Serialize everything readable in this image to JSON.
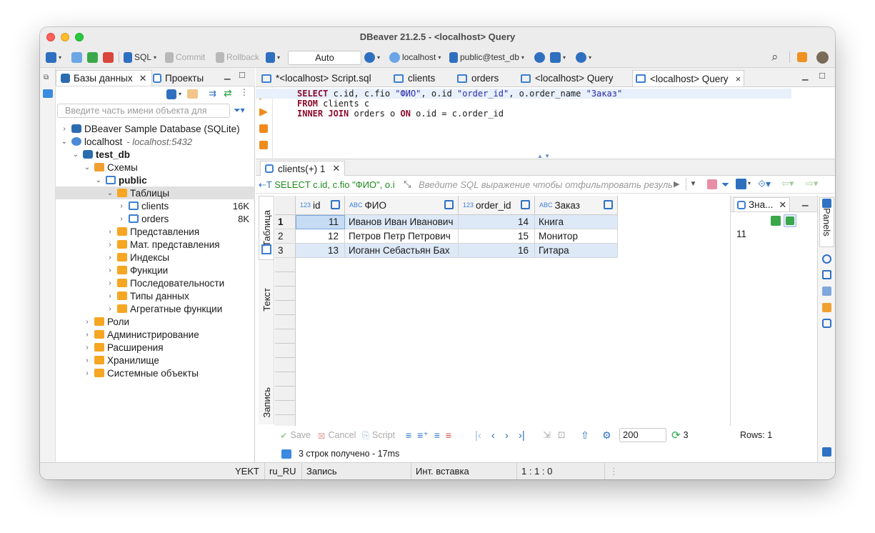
{
  "window": {
    "title": "DBeaver 21.2.5 - <localhost> Query"
  },
  "toolbar": {
    "sql_label": "SQL",
    "commit_label": "Commit",
    "rollback_label": "Rollback",
    "transaction_mode": "Auto",
    "connection_label": "localhost",
    "schema_label": "public@test_db"
  },
  "navigator": {
    "tab_databases": "Базы данных",
    "tab_projects": "Проекты",
    "filter_placeholder": "Введите часть имени объекта для"
  },
  "tree": [
    {
      "label": "DBeaver Sample Database (SQLite)",
      "arrow": "›",
      "icon": "sqlite-icon"
    },
    {
      "label": "localhost",
      "suffix": "- localhost:5432",
      "arrow": "⌄",
      "icon": "postgres-connection-icon"
    },
    {
      "label": "test_db",
      "arrow": "⌄",
      "icon": "database-icon"
    },
    {
      "label": "Схемы",
      "arrow": "⌄",
      "icon": "schemas-folder-icon"
    },
    {
      "label": "public",
      "arrow": "⌄",
      "icon": "schema-icon"
    },
    {
      "label": "Таблицы",
      "arrow": "⌄",
      "icon": "tables-folder-icon"
    },
    {
      "label": "clients",
      "size": "16K",
      "arrow": "›",
      "icon": "table-icon"
    },
    {
      "label": "orders",
      "size": "8K",
      "arrow": "›",
      "icon": "table-icon"
    },
    {
      "label": "Представления",
      "arrow": "›",
      "icon": "views-folder-icon"
    },
    {
      "label": "Мат. представления",
      "arrow": "›",
      "icon": "mviews-folder-icon"
    },
    {
      "label": "Индексы",
      "arrow": "›",
      "icon": "folder-icon"
    },
    {
      "label": "Функции",
      "arrow": "›",
      "icon": "folder-icon"
    },
    {
      "label": "Последовательности",
      "arrow": "›",
      "icon": "folder-icon"
    },
    {
      "label": "Типы данных",
      "arrow": "›",
      "icon": "folder-icon"
    },
    {
      "label": "Агрегатные функции",
      "arrow": "›",
      "icon": "folder-icon"
    },
    {
      "label": "Роли",
      "arrow": "›",
      "icon": "roles-folder-icon"
    },
    {
      "label": "Администрирование",
      "arrow": "›",
      "icon": "admin-folder-icon"
    },
    {
      "label": "Расширения",
      "arrow": "›",
      "icon": "extensions-folder-icon"
    },
    {
      "label": "Хранилище",
      "arrow": "›",
      "icon": "storage-folder-icon"
    },
    {
      "label": "Системные объекты",
      "arrow": "›",
      "icon": "system-folder-icon"
    }
  ],
  "editor_tabs": [
    {
      "label": "*<localhost> Script.sql"
    },
    {
      "label": "clients"
    },
    {
      "label": "orders"
    },
    {
      "label": "<localhost> Query"
    },
    {
      "label": "<localhost> Query",
      "close": "×"
    }
  ],
  "sql": {
    "line1": {
      "kw": "SELECT",
      "rest_a": " c.id, c.fio ",
      "alias1": "\"ФИО\"",
      "rest_b": ", o.id ",
      "alias2": "\"order_id\"",
      "rest_c": ", o.order_name ",
      "alias3": "\"Заказ\""
    },
    "line2": {
      "kw": "FROM",
      "rest": " clients c"
    },
    "line3": {
      "kw1": "INNER JOIN",
      "rest_a": " orders o ",
      "kw2": "ON",
      "rest_b": " o.id = c.order_id"
    }
  },
  "results": {
    "tab_label": "clients(+) 1",
    "query_preview": "SELECT c.id, c.fio \"ФИО\", o.i",
    "filter_hint": "Введите SQL выражение чтобы отфильтровать результа",
    "side_tabs": {
      "table": "Таблица",
      "text": "Текст",
      "record": "Запись"
    },
    "columns": [
      {
        "name": "id",
        "type": "123"
      },
      {
        "name": "ФИО",
        "type": "ABC"
      },
      {
        "name": "order_id",
        "type": "123"
      },
      {
        "name": "Заказ",
        "type": "ABC"
      }
    ],
    "rows": [
      {
        "n": "1",
        "id": "11",
        "fio": "Иванов Иван Иванович",
        "order_id": "14",
        "order": "Книга"
      },
      {
        "n": "2",
        "id": "12",
        "fio": "Петров Петр Петрович",
        "order_id": "15",
        "order": "Монитор"
      },
      {
        "n": "3",
        "id": "13",
        "fio": "Иоганн Себастьян Бах",
        "order_id": "16",
        "order": "Гитара"
      }
    ],
    "value_panel_tab": "Зна...",
    "value_panel_value": "11",
    "panels_label": "Panels",
    "bottom": {
      "save": "Save",
      "cancel": "Cancel",
      "script": "Script",
      "fetch_size": "200",
      "count": "3",
      "rows": "Rows: 1",
      "status": "3 строк получено - 17ms"
    }
  },
  "statusbar": {
    "timezone": "YEKT",
    "locale": "ru_RU",
    "mode": "Запись",
    "insert_mode": "Инт. вставка",
    "position": "1 : 1 : 0"
  }
}
